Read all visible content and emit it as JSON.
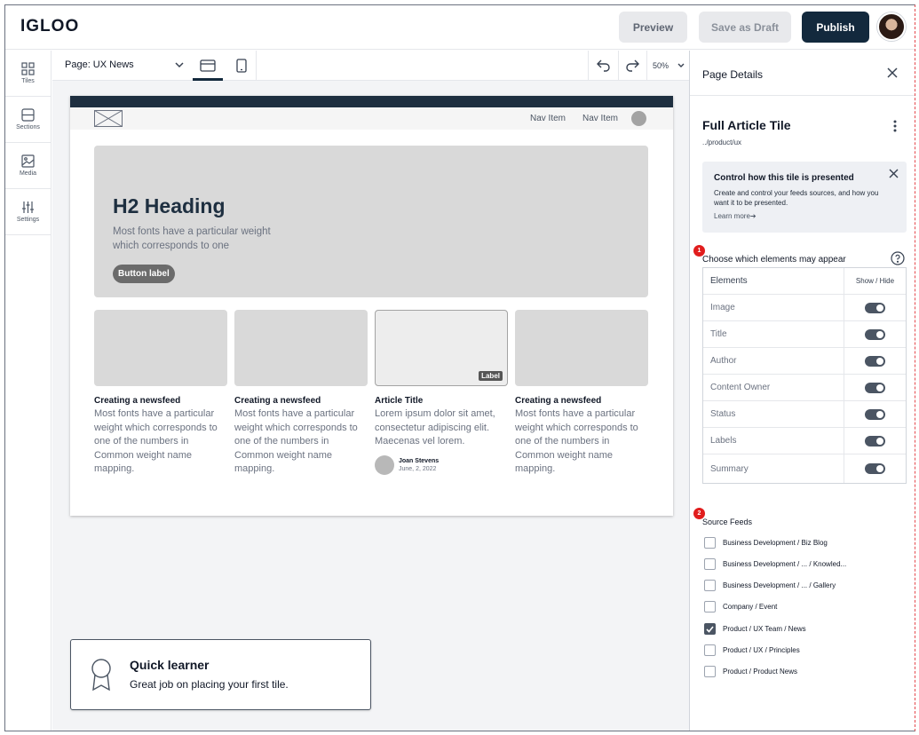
{
  "header": {
    "logo": "IGLOO",
    "preview": "Preview",
    "save_draft": "Save as Draft",
    "publish": "Publish"
  },
  "rail": [
    {
      "label": "Tiles",
      "icon": "grid-icon"
    },
    {
      "label": "Sections",
      "icon": "sections-icon"
    },
    {
      "label": "Media",
      "icon": "image-icon"
    },
    {
      "label": "Settings",
      "icon": "sliders-icon"
    }
  ],
  "toolbar": {
    "page": "Page: UX News",
    "zoom": "50%"
  },
  "preview": {
    "nav": [
      "Nav Item",
      "Nav Item"
    ],
    "hero": {
      "heading": "H2 Heading",
      "text": "Most fonts have a particular weight which corresponds to one",
      "button": "Button label"
    },
    "cards": [
      {
        "title": "Creating a newsfeed",
        "text": "Most fonts have a particular weight which corresponds to one of the numbers in Common weight name mapping."
      },
      {
        "title": "Creating a newsfeed",
        "text": "Most fonts have a particular weight which corresponds to one of the numbers in Common weight name mapping."
      },
      {
        "title": "Article Title",
        "text": "Lorem ipsum dolor sit amet, consectetur adipiscing elit. Maecenas vel lorem.",
        "tag": "Label",
        "author": "Joan Stevens",
        "date": "June, 2, 2022"
      },
      {
        "title": "Creating a newsfeed",
        "text": "Most fonts have a particular weight which corresponds to one of the numbers in Common weight name mapping."
      }
    ]
  },
  "toast": {
    "title": "Quick learner",
    "message": "Great job on placing your first tile."
  },
  "panel": {
    "title": "Page Details",
    "tile_name": "Full Article Tile",
    "tile_path": "../product/ux",
    "info": {
      "title": "Control how this tile is presented",
      "text": "Create and control your feeds sources, and how you want it to be presented.",
      "link": "Learn more"
    },
    "elements_label": "Choose which elements may appear",
    "badge1": "1",
    "badge2": "2",
    "table": {
      "col1": "Elements",
      "col2": "Show / Hide",
      "rows": [
        {
          "label": "Image",
          "on": true
        },
        {
          "label": "Title",
          "on": true
        },
        {
          "label": "Author",
          "on": true
        },
        {
          "label": "Content Owner",
          "on": true
        },
        {
          "label": "Status",
          "on": true
        },
        {
          "label": "Labels",
          "on": true
        },
        {
          "label": "Summary",
          "on": true
        }
      ]
    },
    "feeds_label": "Source Feeds",
    "feeds": [
      {
        "label": "Business Development / Biz Blog",
        "checked": false
      },
      {
        "label": "Business Development / ...  / Knowled...",
        "checked": false
      },
      {
        "label": "Business Development / ...  / Gallery",
        "checked": false
      },
      {
        "label": "Company / Event",
        "checked": false
      },
      {
        "label": "Product / UX Team / News",
        "checked": true
      },
      {
        "label": "Product / UX / Principles",
        "checked": false
      },
      {
        "label": "Product / Product News",
        "checked": false
      }
    ]
  }
}
